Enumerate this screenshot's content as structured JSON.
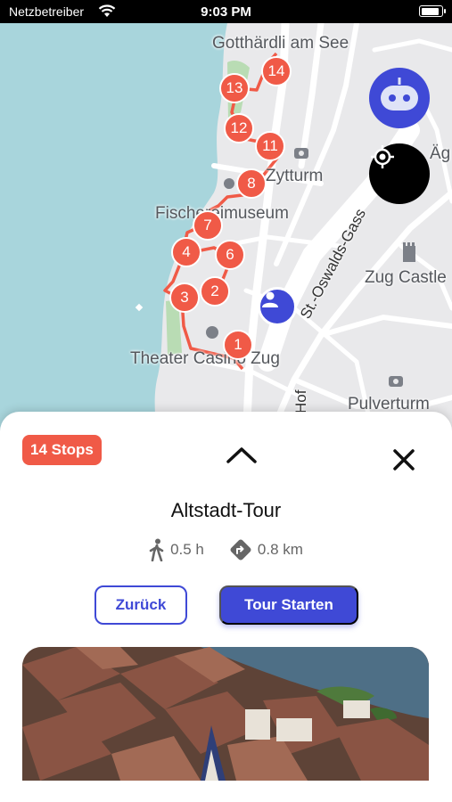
{
  "status_bar": {
    "carrier": "Netzbetreiber",
    "time": "9:03 PM",
    "battery_level": 0.95
  },
  "map": {
    "labels": {
      "gotthardli": "Gotthärdli am See",
      "zytturm": "Zytturm",
      "fischereimuseum": "Fischereimuseum",
      "st_oswalds": "St.-Oswalds-Gass",
      "zug_castle": "Zug Castle",
      "theater": "Theater Casino Zug",
      "hof": "Hof",
      "pulverturm": "Pulverturm",
      "aeg": "Äg"
    },
    "stops": [
      "1",
      "2",
      "3",
      "4",
      "6",
      "7",
      "8",
      "11",
      "12",
      "13",
      "14"
    ],
    "colors": {
      "water": "#a8d5dc",
      "route": "#f05a47",
      "park": "#b9dcb4",
      "accent": "#3f49d6"
    }
  },
  "sheet": {
    "stops_badge": "14 Stops",
    "title": "Altstadt-Tour",
    "duration": "0.5 h",
    "distance": "0.8 km",
    "back_label": "Zurück",
    "start_label": "Tour Starten"
  }
}
